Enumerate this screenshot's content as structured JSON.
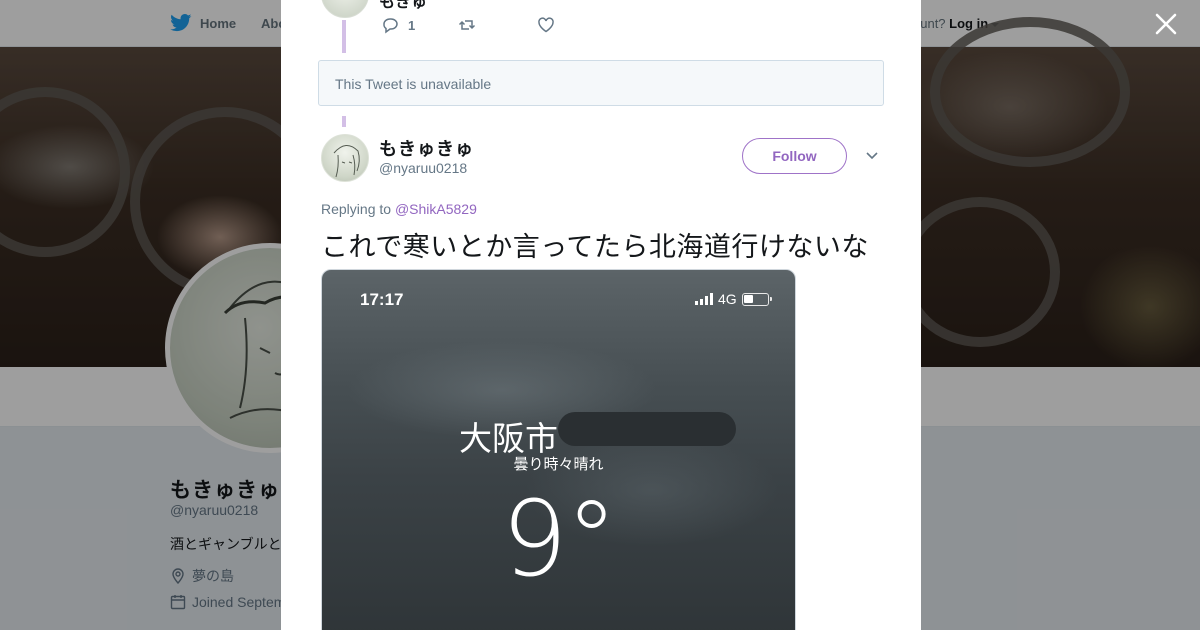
{
  "topnav": {
    "home_label": "Home",
    "about_label": "Abo",
    "account_prompt": "ccount?",
    "login_label": "Log in"
  },
  "profile": {
    "name": "もきゅきゅ",
    "handle": "@nyaruu0218",
    "bio": "酒とギャンブルと",
    "location": "夢の島",
    "joined": "Joined Septem"
  },
  "previous_tweet": {
    "name": "もきゅ",
    "reply_count": "1"
  },
  "unavailable_notice": "This Tweet is unavailable",
  "tweet": {
    "author_name": "もきゅきゅ",
    "author_handle": "@nyaruu0218",
    "follow_label": "Follow",
    "replying_prefix": "Replying to",
    "replying_to": "@ShikA5829",
    "text": "これで寒いとか言ってたら北海道行けないな",
    "media": {
      "time": "17:17",
      "network": "4G",
      "city": "大阪市",
      "condition": "曇り時々晴れ",
      "temperature": "9°"
    }
  },
  "colors": {
    "accent": "#9266c0",
    "thread_line": "#d3bfe6",
    "twitter_blue": "#1da1f2"
  }
}
